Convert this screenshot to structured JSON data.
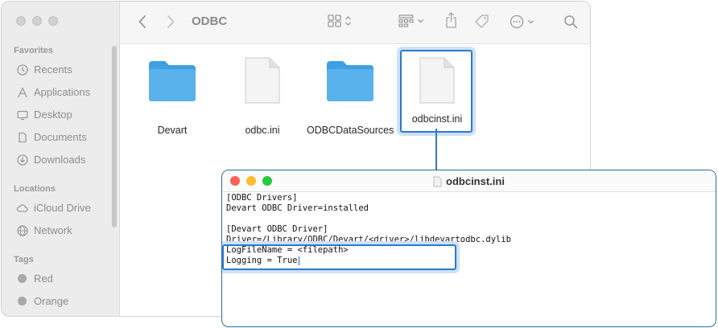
{
  "finder": {
    "title": "ODBC",
    "sidebar": {
      "favorites_label": "Favorites",
      "favorites": [
        {
          "label": "Recents",
          "icon": "clock-icon"
        },
        {
          "label": "Applications",
          "icon": "applications-icon"
        },
        {
          "label": "Desktop",
          "icon": "desktop-icon"
        },
        {
          "label": "Documents",
          "icon": "document-icon"
        },
        {
          "label": "Downloads",
          "icon": "download-icon"
        }
      ],
      "locations_label": "Locations",
      "locations": [
        {
          "label": "iCloud Drive",
          "icon": "cloud-icon"
        },
        {
          "label": "Network",
          "icon": "globe-icon"
        }
      ],
      "tags_label": "Tags",
      "tags": [
        {
          "label": "Red"
        },
        {
          "label": "Orange"
        }
      ]
    },
    "files": [
      {
        "name": "Devart",
        "type": "folder"
      },
      {
        "name": "odbc.ini",
        "type": "document"
      },
      {
        "name": "ODBCDataSources",
        "type": "folder"
      },
      {
        "name": "odbcinst.ini",
        "type": "document",
        "selected": true
      }
    ]
  },
  "editor": {
    "title": "odbcinst.ini",
    "lines": [
      "[ODBC Drivers]",
      "Devart ODBC Driver=installed",
      "",
      "[Devart ODBC Driver]",
      "Driver=/Library/ODBC/Devart/<driver>/libdevartodbc.dylib",
      "LogFileName = <filepath>",
      "Logging = True"
    ]
  },
  "colors": {
    "selection_border": "#2b79d6",
    "folder_blue": "#5ab2ec",
    "close": "#fe5f57",
    "minimize": "#febc2e",
    "zoom": "#28c840"
  }
}
